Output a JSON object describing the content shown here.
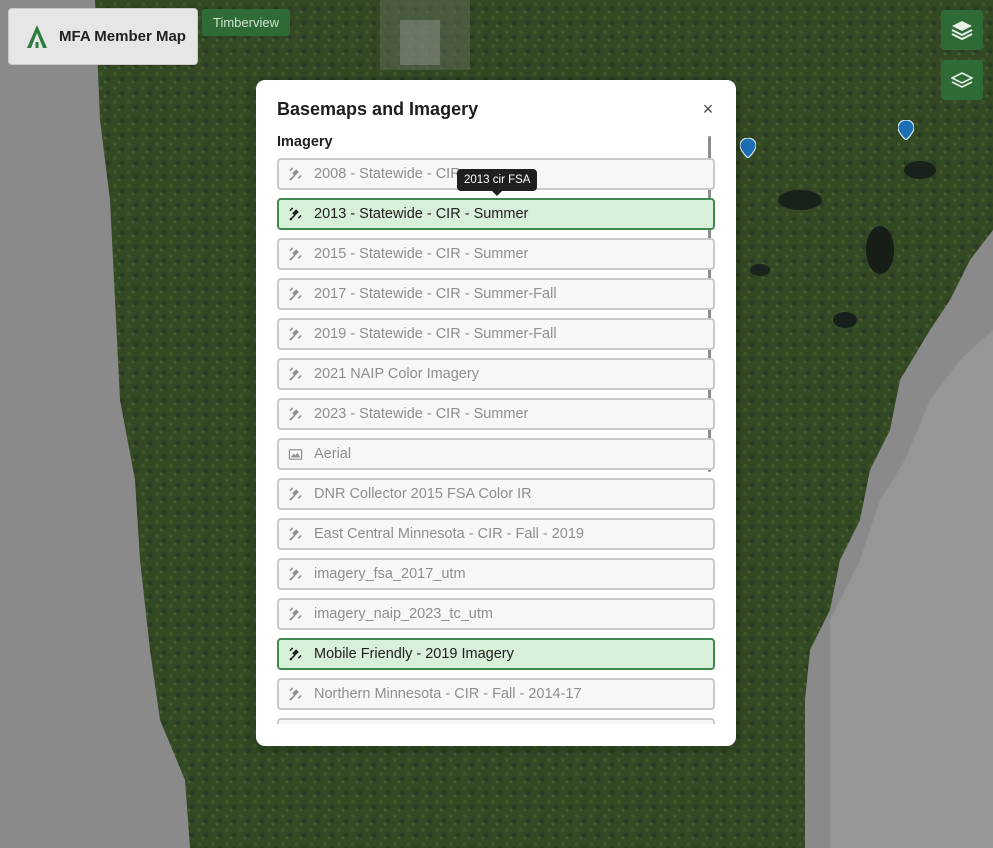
{
  "app": {
    "title": "MFA Member Map",
    "location_badge": "Timberview"
  },
  "map_controls": {
    "layers_icon": "layers-icon",
    "basemap_icon": "basemap-icon"
  },
  "modal": {
    "title": "Basemaps and Imagery",
    "close_label": "×",
    "section_label": "Imagery",
    "tooltip": "2013 cir FSA",
    "items": [
      {
        "label": "2008 - Statewide - CIR",
        "icon": "satellite-icon",
        "active": false
      },
      {
        "label": "2013 - Statewide - CIR - Summer",
        "icon": "satellite-icon",
        "active": true
      },
      {
        "label": "2015 - Statewide - CIR - Summer",
        "icon": "satellite-icon",
        "active": false
      },
      {
        "label": "2017 - Statewide - CIR - Summer-Fall",
        "icon": "satellite-icon",
        "active": false
      },
      {
        "label": "2019 - Statewide - CIR - Summer-Fall",
        "icon": "satellite-icon",
        "active": false
      },
      {
        "label": "2021 NAIP Color Imagery",
        "icon": "satellite-icon",
        "active": false
      },
      {
        "label": "2023 - Statewide - CIR - Summer",
        "icon": "satellite-icon",
        "active": false
      },
      {
        "label": "Aerial",
        "icon": "photo-map-icon",
        "active": false
      },
      {
        "label": "DNR Collector 2015 FSA Color IR",
        "icon": "satellite-icon",
        "active": false
      },
      {
        "label": "East Central Minnesota - CIR - Fall - 2019",
        "icon": "satellite-icon",
        "active": false
      },
      {
        "label": "imagery_fsa_2017_utm",
        "icon": "satellite-icon",
        "active": false
      },
      {
        "label": "imagery_naip_2023_tc_utm",
        "icon": "satellite-icon",
        "active": false
      },
      {
        "label": "Mobile Friendly - 2019 Imagery",
        "icon": "satellite-icon",
        "active": true
      },
      {
        "label": "Northern Minnesota - CIR - Fall - 2014-17",
        "icon": "satellite-icon",
        "active": false
      }
    ]
  },
  "colors": {
    "brand_green": "#2f6b37",
    "active_border": "#3f8a4c",
    "active_fill": "#d8efd9"
  }
}
